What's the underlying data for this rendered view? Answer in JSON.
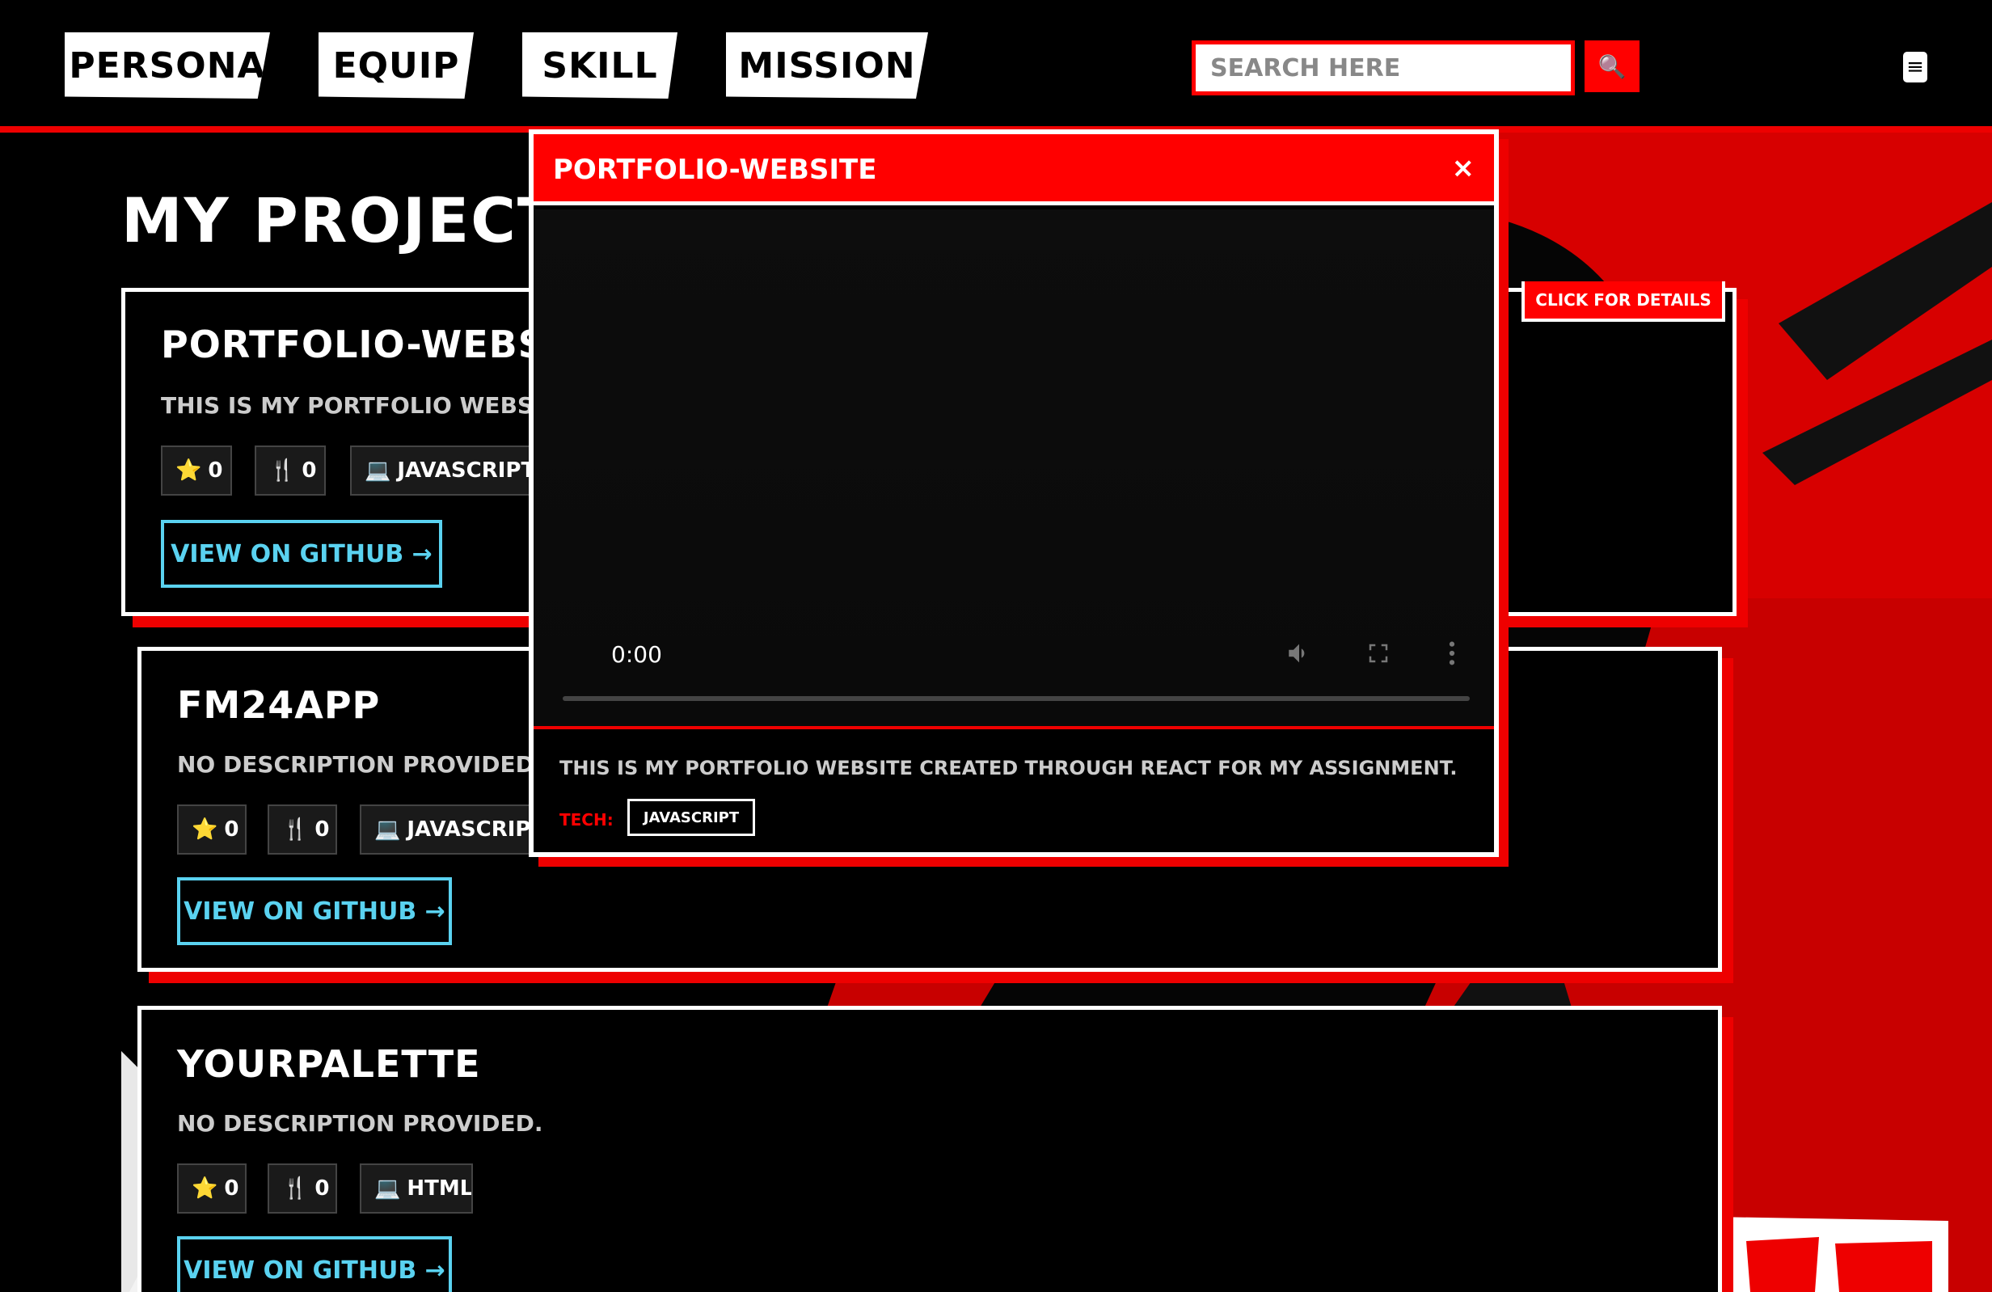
{
  "nav": {
    "tabs": [
      {
        "label": "PERSONA"
      },
      {
        "label": "EQUIP"
      },
      {
        "label": "SKILL"
      },
      {
        "label": "MISSION"
      }
    ],
    "search": {
      "placeholder": "SEARCH HERE"
    },
    "search_button_icon": "search-icon",
    "menu_icon": "menu-icon"
  },
  "page_title": "MY PROJECTS",
  "details_badge": "CLICK FOR DETAILS",
  "projects": [
    {
      "name": "PORTFOLIO-WEBSITE",
      "description": "THIS IS MY PORTFOLIO WEBSITE CREATED THROUGH REACT FOR MY ASSIGNMENT.",
      "stars": "0",
      "forks": "0",
      "language": "JAVASCRIPT",
      "button": "VIEW ON GITHUB →"
    },
    {
      "name": "FM24APP",
      "description": "NO DESCRIPTION PROVIDED.",
      "stars": "0",
      "forks": "0",
      "language": "JAVASCRIPT",
      "button": "VIEW ON GITHUB →"
    },
    {
      "name": "YOURPALETTE",
      "description": "NO DESCRIPTION PROVIDED.",
      "stars": "0",
      "forks": "0",
      "language": "HTML",
      "button": "VIEW ON GITHUB →"
    }
  ],
  "modal": {
    "title": "PORTFOLIO-WEBSITE",
    "close": "×",
    "video_time": "0:00",
    "description": "THIS IS MY PORTFOLIO WEBSITE CREATED THROUGH REACT FOR MY ASSIGNMENT.",
    "tech_label": "TECH:",
    "tech": "JAVASCRIPT"
  },
  "icons": {
    "star": "⭐",
    "fork": "🍴",
    "language": "💻",
    "search": "🔍",
    "menu": "≡"
  },
  "colors": {
    "accent": "#ff0000",
    "link": "#5ad2f0",
    "background": "#000000"
  }
}
